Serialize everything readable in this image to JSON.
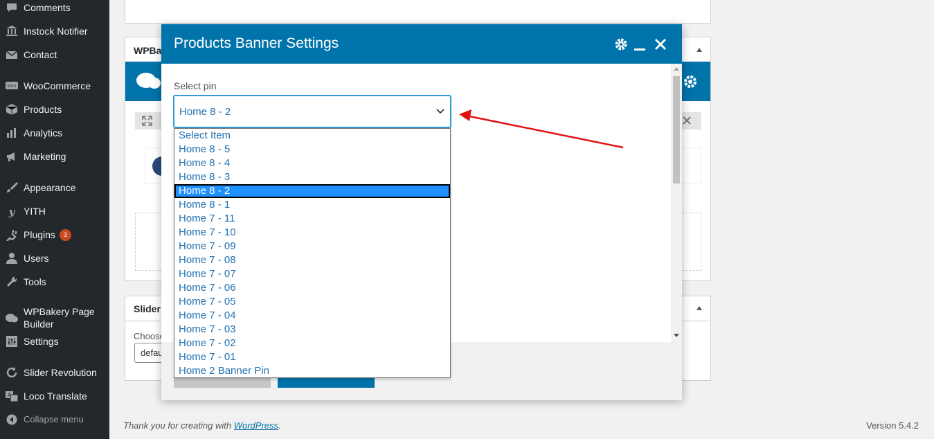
{
  "sidebar": {
    "items": [
      {
        "label": "Comments",
        "icon": "comment-icon"
      },
      {
        "label": "Instock Notifier",
        "icon": "bank-icon"
      },
      {
        "label": "Contact",
        "icon": "envelope-icon"
      },
      {
        "label": "WooCommerce",
        "icon": "woo-icon"
      },
      {
        "label": "Products",
        "icon": "box-icon"
      },
      {
        "label": "Analytics",
        "icon": "bar-chart-icon"
      },
      {
        "label": "Marketing",
        "icon": "megaphone-icon"
      },
      {
        "label": "Appearance",
        "icon": "paintbrush-icon"
      },
      {
        "label": "YITH",
        "icon": "yith-icon"
      },
      {
        "label": "Plugins",
        "icon": "plug-icon",
        "badge": "3"
      },
      {
        "label": "Users",
        "icon": "user-icon"
      },
      {
        "label": "Tools",
        "icon": "wrench-icon"
      },
      {
        "label": "WPBakery Page Builder",
        "icon": "cloud-icon"
      },
      {
        "label": "Settings",
        "icon": "sliders-icon"
      },
      {
        "label": "Slider Revolution",
        "icon": "refresh-icon"
      },
      {
        "label": "Loco Translate",
        "icon": "translate-icon"
      }
    ],
    "collapse_label": "Collapse menu",
    "badge_color": "#ca4a1f"
  },
  "background": {
    "wpbakery_box_title": "WPBal",
    "slider_box_title": "Slider",
    "slider_field_label": "Choose",
    "slider_field_value": "defau"
  },
  "modal": {
    "title": "Products Banner Settings",
    "header_color": "#0073aa",
    "field_label": "Select pin",
    "selected_value": "Home 8 - 2",
    "options": [
      "Select Item",
      "Home 8 - 5",
      "Home 8 - 4",
      "Home 8 - 3",
      "Home 8 - 2",
      "Home 8 - 1",
      "Home 7 - 11",
      "Home 7 - 10",
      "Home 7 - 09",
      "Home 7 - 08",
      "Home 7 - 07",
      "Home 7 - 06",
      "Home 7 - 05",
      "Home 7 - 04",
      "Home 7 - 03",
      "Home 7 - 02",
      "Home 7 - 01",
      "Home 2 Banner Pin"
    ],
    "highlighted_index": 4
  },
  "annotation": {
    "arrow_color": "#e01010"
  },
  "footer": {
    "thanks_prefix": "Thank you for creating with ",
    "thanks_link": "WordPress",
    "thanks_suffix": ".",
    "version": "Version 5.4.2"
  }
}
